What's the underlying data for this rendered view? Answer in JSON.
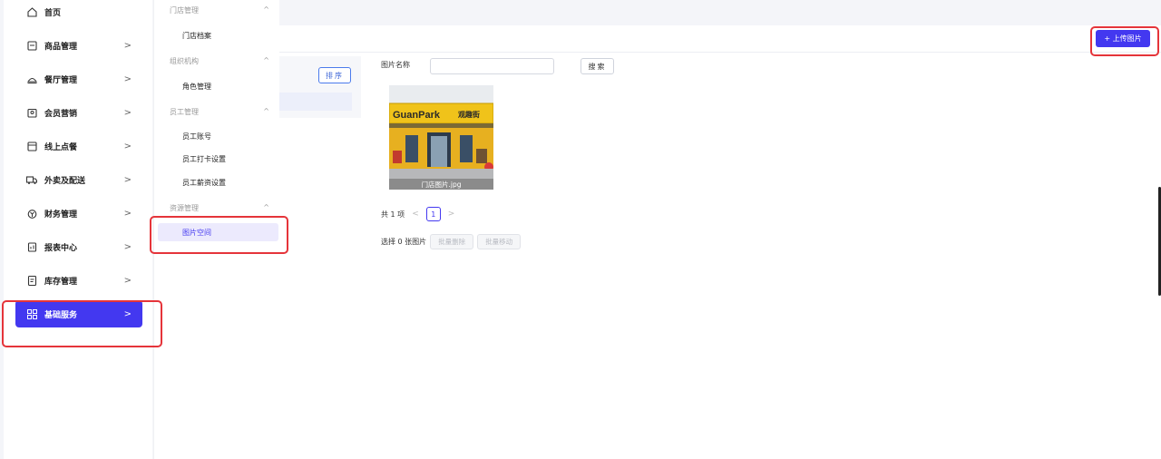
{
  "sidebar": {
    "items": [
      {
        "label": "首页",
        "icon": "home-icon",
        "has_chevron": false
      },
      {
        "label": "商品管理",
        "icon": "product-icon",
        "has_chevron": true
      },
      {
        "label": "餐厅管理",
        "icon": "restaurant-icon",
        "has_chevron": true
      },
      {
        "label": "会员营销",
        "icon": "member-icon",
        "has_chevron": true
      },
      {
        "label": "线上点餐",
        "icon": "online-order-icon",
        "has_chevron": true
      },
      {
        "label": "外卖及配送",
        "icon": "delivery-truck-icon",
        "has_chevron": true
      },
      {
        "label": "财务管理",
        "icon": "finance-icon",
        "has_chevron": true
      },
      {
        "label": "报表中心",
        "icon": "report-icon",
        "has_chevron": true
      },
      {
        "label": "库存管理",
        "icon": "inventory-icon",
        "has_chevron": true
      },
      {
        "label": "基础服务",
        "icon": "grid-icon",
        "has_chevron": true,
        "active": true
      }
    ],
    "chevron": ">"
  },
  "submenu": {
    "groups": [
      {
        "title": "门店管理",
        "items": [
          "门店档案"
        ]
      },
      {
        "title": "组织机构",
        "items": [
          "角色管理"
        ]
      },
      {
        "title": "员工管理",
        "items": [
          "员工账号",
          "员工打卡设置",
          "员工薪资设置"
        ]
      },
      {
        "title": "资源管理",
        "items": [
          "图片空间"
        ]
      }
    ],
    "active_item": "图片空间",
    "caret": "^"
  },
  "header": {
    "upload_label": "+ 上传图片"
  },
  "left_panel": {
    "sort_label": "排序"
  },
  "filter": {
    "label": "图片名称",
    "input_value": "",
    "search_label": "搜索"
  },
  "gallery": {
    "images": [
      {
        "name": "门店图片.jpg",
        "sign_text": "GuanPark",
        "sign_text_cn": "观趣街"
      }
    ]
  },
  "pagination": {
    "total_text": "共 1 项",
    "current_page": "1",
    "prev": "<",
    "next": ">"
  },
  "batch": {
    "selected_text": "选择 0 张图片",
    "delete_label": "批量删除",
    "move_label": "批量移动"
  },
  "colors": {
    "accent": "#4338f0",
    "highlight_border": "#e5343a",
    "sort_border": "#4b7bec"
  }
}
